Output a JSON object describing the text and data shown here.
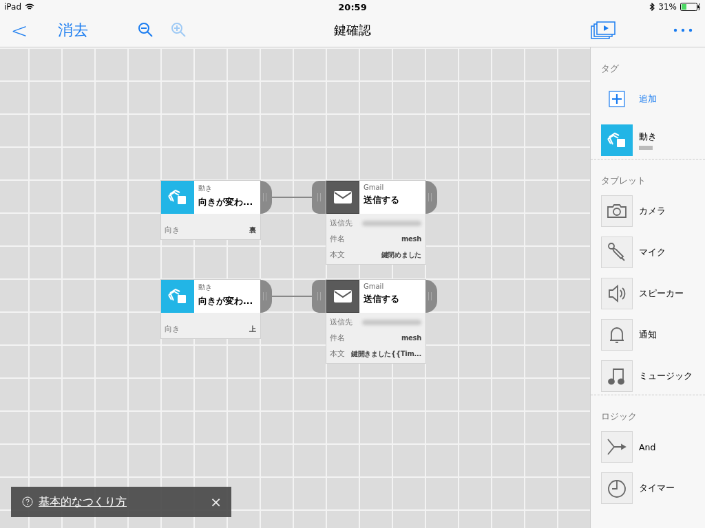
{
  "status_bar": {
    "device": "iPad",
    "time": "20:59",
    "battery": "31%"
  },
  "nav": {
    "back": "<",
    "clear": "消去",
    "title": "鍵確認",
    "zoom_out": {
      "disabled": false
    },
    "zoom_in": {
      "disabled": true
    }
  },
  "flows": [
    {
      "trigger": {
        "category": "動き",
        "title": "向きが変わ...",
        "params": [
          {
            "label": "向き",
            "value": "裏"
          }
        ]
      },
      "action": {
        "category": "Gmail",
        "title": "送信する",
        "params": [
          {
            "label": "送信先",
            "kind": "hidden"
          },
          {
            "label": "件名",
            "value": "mesh",
            "kind": "text"
          },
          {
            "label": "本文",
            "value": "鍵閉めました",
            "kind": "text"
          }
        ]
      }
    },
    {
      "trigger": {
        "category": "動き",
        "title": "向きが変わ...",
        "params": [
          {
            "label": "向き",
            "value": "上"
          }
        ]
      },
      "action": {
        "category": "Gmail",
        "title": "送信する",
        "params": [
          {
            "label": "送信先",
            "kind": "hidden"
          },
          {
            "label": "件名",
            "value": "mesh",
            "kind": "text"
          },
          {
            "label": "本文",
            "value": "鍵開きました{{Tim...",
            "kind": "text"
          }
        ]
      }
    }
  ],
  "sidebar": {
    "sections": [
      {
        "title": "タグ",
        "items": [
          {
            "label": "追加",
            "kind": "add"
          },
          {
            "label": "動き",
            "kind": "motion"
          }
        ]
      },
      {
        "title": "タブレット",
        "items": [
          {
            "label": "カメラ",
            "kind": "camera"
          },
          {
            "label": "マイク",
            "kind": "mic"
          },
          {
            "label": "スピーカー",
            "kind": "speaker"
          },
          {
            "label": "通知",
            "kind": "bell"
          },
          {
            "label": "ミュージック",
            "kind": "music"
          }
        ]
      },
      {
        "title": "ロジック",
        "items": [
          {
            "label": "And",
            "kind": "and"
          },
          {
            "label": "タイマー",
            "kind": "timer"
          }
        ]
      }
    ]
  },
  "help_banner": {
    "link": "基本的なつくり方",
    "close": "×"
  }
}
